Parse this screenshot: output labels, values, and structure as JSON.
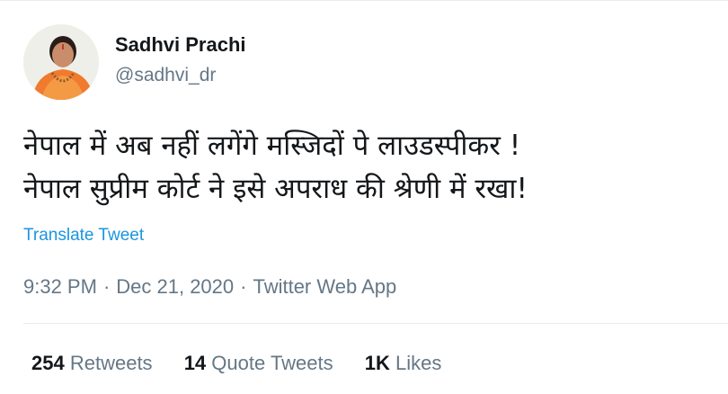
{
  "user": {
    "display_name": "Sadhvi Prachi",
    "handle": "@sadhvi_dr"
  },
  "tweet": {
    "lines": [
      "नेपाल में अब नहीं लगेंगे मस्जिदों पे लाउडस्पीकर !",
      "नेपाल सुप्रीम कोर्ट ने इसे अपराध की श्रेणी में रखा!"
    ],
    "translate_label": "Translate Tweet"
  },
  "meta": {
    "time": "9:32 PM",
    "separator": "·",
    "date": "Dec 21, 2020",
    "source": "Twitter Web App"
  },
  "stats": {
    "retweets": {
      "count": "254",
      "label": "Retweets"
    },
    "quote_tweets": {
      "count": "14",
      "label": "Quote Tweets"
    },
    "likes": {
      "count": "1K",
      "label": "Likes"
    }
  },
  "colors": {
    "text": "#14171a",
    "secondary": "#657786",
    "link": "#1b95e0",
    "border": "#e6ecf0"
  }
}
